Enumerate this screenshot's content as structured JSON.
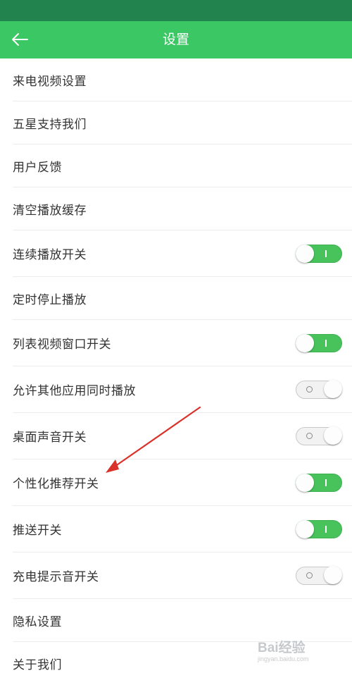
{
  "header": {
    "title": "设置",
    "back_icon": "arrow-left-icon"
  },
  "colors": {
    "status_bar": "#22834f",
    "app_bar": "#3bc763",
    "switch_on": "#48c35c",
    "switch_off": "#f2f2f2"
  },
  "settings": {
    "items": [
      {
        "label": "来电视频设置"
      },
      {
        "label": "五星支持我们"
      },
      {
        "label": "用户反馈"
      },
      {
        "label": "清空播放缓存"
      },
      {
        "label": "连续播放开关",
        "switch": "on"
      },
      {
        "label": "定时停止播放"
      },
      {
        "label": "列表视频窗口开关",
        "switch": "on"
      },
      {
        "label": "允许其他应用同时播放",
        "switch": "off"
      },
      {
        "label": "桌面声音开关",
        "switch": "off"
      },
      {
        "label": "个性化推荐开关",
        "switch": "on"
      },
      {
        "label": "推送开关",
        "switch": "on"
      },
      {
        "label": "充电提示音开关",
        "switch": "off"
      },
      {
        "label": "隐私设置"
      },
      {
        "label": "关于我们"
      }
    ]
  },
  "watermark": {
    "text": "Bai经验",
    "sub": "jingyan.baidu.com"
  }
}
